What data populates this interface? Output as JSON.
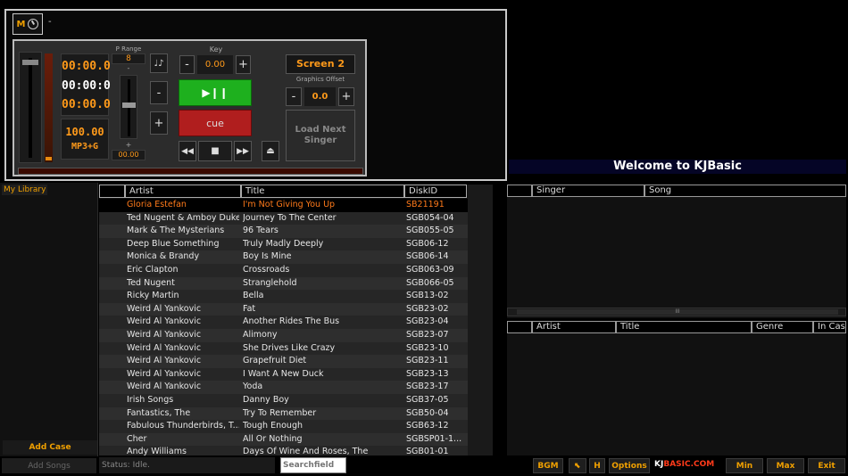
{
  "top": {
    "m_label": "M",
    "dash": "-"
  },
  "player": {
    "time1": "00:00.0",
    "time2": "00:00:0",
    "time3": "00:00.0",
    "tempo": "100.00",
    "format": "MP3+G",
    "prange_label": "P Range",
    "prange_value": "8",
    "pitch_minus": "-",
    "pitch_plus": "+",
    "pitch_value": "00.00",
    "key_label": "Key",
    "key_value": "0.00",
    "key_minus": "-",
    "key_plus": "+",
    "cue_label": "cue",
    "screen_label": "Screen 2",
    "graphics_offset_label": "Graphics Offset",
    "graphics_value": "0.0",
    "load_next_label": "Load Next Singer",
    "side_minus": "-",
    "side_plus": "+"
  },
  "welcome": "Welcome to KJBasic",
  "library": {
    "tab": "My Library",
    "add_case": "Add Case",
    "add_songs": "Add Songs"
  },
  "songs": {
    "columns": [
      "Artist",
      "Title",
      "DiskID"
    ],
    "rows": [
      [
        "Gloria Estefan",
        "I'm Not Giving You Up",
        "SB21191"
      ],
      [
        "Ted Nugent & Amboy Dukes",
        "Journey To The Center",
        "SGB054-04"
      ],
      [
        "Mark & The Mysterians",
        "96 Tears",
        "SGB055-05"
      ],
      [
        "Deep Blue Something",
        "Truly Madly Deeply",
        "SGB06-12"
      ],
      [
        "Monica & Brandy",
        "Boy Is Mine",
        "SGB06-14"
      ],
      [
        "Eric Clapton",
        "Crossroads",
        "SGB063-09"
      ],
      [
        "Ted Nugent",
        "Stranglehold",
        "SGB066-05"
      ],
      [
        "Ricky Martin",
        "Bella",
        "SGB13-02"
      ],
      [
        "Weird Al Yankovic",
        "Fat",
        "SGB23-02"
      ],
      [
        "Weird Al Yankovic",
        "Another Rides The Bus",
        "SGB23-04"
      ],
      [
        "Weird Al Yankovic",
        "Alimony",
        "SGB23-07"
      ],
      [
        "Weird Al Yankovic",
        "She Drives Like Crazy",
        "SGB23-10"
      ],
      [
        "Weird Al Yankovic",
        "Grapefruit Diet",
        "SGB23-11"
      ],
      [
        "Weird Al Yankovic",
        "I Want A New Duck",
        "SGB23-13"
      ],
      [
        "Weird Al Yankovic",
        "Yoda",
        "SGB23-17"
      ],
      [
        "Irish Songs",
        "Danny Boy",
        "SGB37-05"
      ],
      [
        "Fantastics, The",
        "Try To Remember",
        "SGB50-04"
      ],
      [
        "Fabulous Thunderbirds, T...",
        "Tough Enough",
        "SGB63-12"
      ],
      [
        "Cher",
        "All Or Nothing",
        "SGBSP01-1..."
      ],
      [
        "Andy Williams",
        "Days Of Wine And Roses, The",
        "SGB01-01"
      ]
    ]
  },
  "queue": {
    "columns": [
      "Singer",
      "Song"
    ]
  },
  "history": {
    "columns": [
      "Artist",
      "Title",
      "Genre",
      "In Case"
    ]
  },
  "scroll_grip": "III",
  "status": "Status: Idle.",
  "search_placeholder": "Searchfield",
  "bottom": {
    "bgm": "BGM",
    "h": "H",
    "options": "Options",
    "logo_kj": "KJ",
    "logo_basic": "BASIC.COM",
    "min": "Min",
    "max": "Max",
    "exit": "Exit"
  },
  "colors": {
    "accent": "#f0a000",
    "play": "#1eb01e",
    "cue": "#b01e1e"
  }
}
